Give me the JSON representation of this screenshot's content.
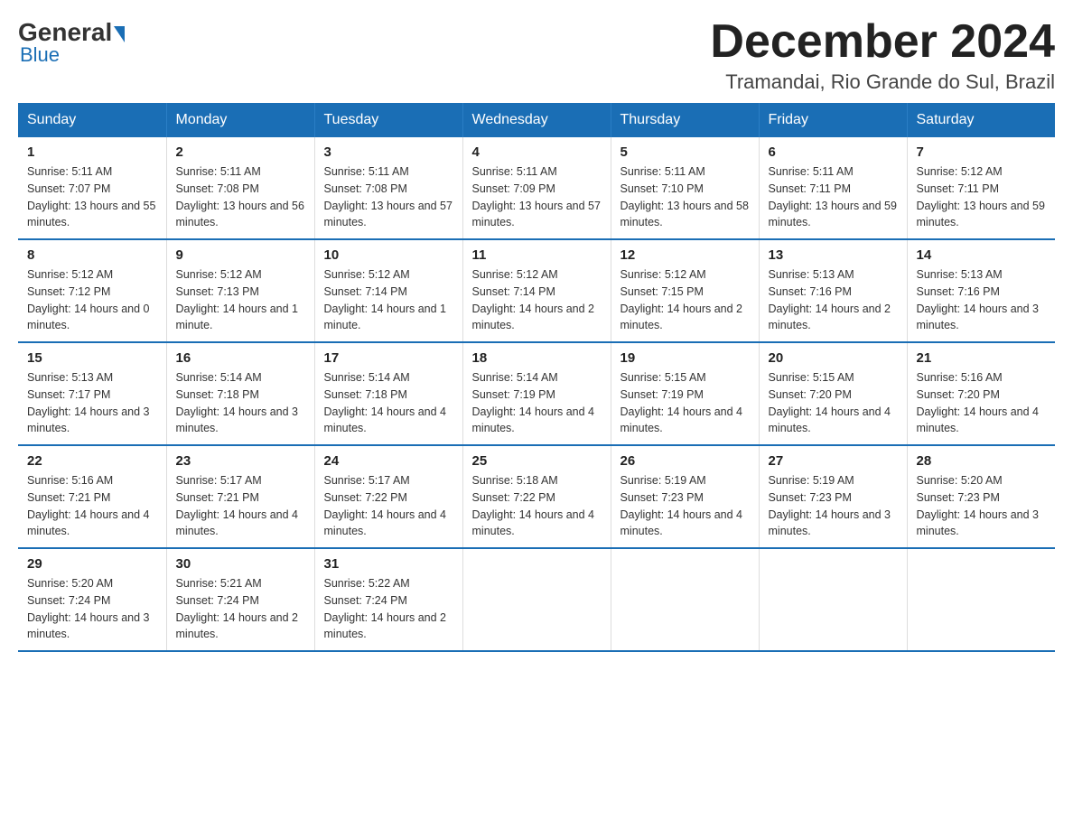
{
  "header": {
    "logo_general": "General",
    "logo_blue": "Blue",
    "month_title": "December 2024",
    "location": "Tramandai, Rio Grande do Sul, Brazil"
  },
  "weekdays": [
    "Sunday",
    "Monday",
    "Tuesday",
    "Wednesday",
    "Thursday",
    "Friday",
    "Saturday"
  ],
  "weeks": [
    [
      {
        "day": "1",
        "sunrise": "5:11 AM",
        "sunset": "7:07 PM",
        "daylight": "13 hours and 55 minutes."
      },
      {
        "day": "2",
        "sunrise": "5:11 AM",
        "sunset": "7:08 PM",
        "daylight": "13 hours and 56 minutes."
      },
      {
        "day": "3",
        "sunrise": "5:11 AM",
        "sunset": "7:08 PM",
        "daylight": "13 hours and 57 minutes."
      },
      {
        "day": "4",
        "sunrise": "5:11 AM",
        "sunset": "7:09 PM",
        "daylight": "13 hours and 57 minutes."
      },
      {
        "day": "5",
        "sunrise": "5:11 AM",
        "sunset": "7:10 PM",
        "daylight": "13 hours and 58 minutes."
      },
      {
        "day": "6",
        "sunrise": "5:11 AM",
        "sunset": "7:11 PM",
        "daylight": "13 hours and 59 minutes."
      },
      {
        "day": "7",
        "sunrise": "5:12 AM",
        "sunset": "7:11 PM",
        "daylight": "13 hours and 59 minutes."
      }
    ],
    [
      {
        "day": "8",
        "sunrise": "5:12 AM",
        "sunset": "7:12 PM",
        "daylight": "14 hours and 0 minutes."
      },
      {
        "day": "9",
        "sunrise": "5:12 AM",
        "sunset": "7:13 PM",
        "daylight": "14 hours and 1 minute."
      },
      {
        "day": "10",
        "sunrise": "5:12 AM",
        "sunset": "7:14 PM",
        "daylight": "14 hours and 1 minute."
      },
      {
        "day": "11",
        "sunrise": "5:12 AM",
        "sunset": "7:14 PM",
        "daylight": "14 hours and 2 minutes."
      },
      {
        "day": "12",
        "sunrise": "5:12 AM",
        "sunset": "7:15 PM",
        "daylight": "14 hours and 2 minutes."
      },
      {
        "day": "13",
        "sunrise": "5:13 AM",
        "sunset": "7:16 PM",
        "daylight": "14 hours and 2 minutes."
      },
      {
        "day": "14",
        "sunrise": "5:13 AM",
        "sunset": "7:16 PM",
        "daylight": "14 hours and 3 minutes."
      }
    ],
    [
      {
        "day": "15",
        "sunrise": "5:13 AM",
        "sunset": "7:17 PM",
        "daylight": "14 hours and 3 minutes."
      },
      {
        "day": "16",
        "sunrise": "5:14 AM",
        "sunset": "7:18 PM",
        "daylight": "14 hours and 3 minutes."
      },
      {
        "day": "17",
        "sunrise": "5:14 AM",
        "sunset": "7:18 PM",
        "daylight": "14 hours and 4 minutes."
      },
      {
        "day": "18",
        "sunrise": "5:14 AM",
        "sunset": "7:19 PM",
        "daylight": "14 hours and 4 minutes."
      },
      {
        "day": "19",
        "sunrise": "5:15 AM",
        "sunset": "7:19 PM",
        "daylight": "14 hours and 4 minutes."
      },
      {
        "day": "20",
        "sunrise": "5:15 AM",
        "sunset": "7:20 PM",
        "daylight": "14 hours and 4 minutes."
      },
      {
        "day": "21",
        "sunrise": "5:16 AM",
        "sunset": "7:20 PM",
        "daylight": "14 hours and 4 minutes."
      }
    ],
    [
      {
        "day": "22",
        "sunrise": "5:16 AM",
        "sunset": "7:21 PM",
        "daylight": "14 hours and 4 minutes."
      },
      {
        "day": "23",
        "sunrise": "5:17 AM",
        "sunset": "7:21 PM",
        "daylight": "14 hours and 4 minutes."
      },
      {
        "day": "24",
        "sunrise": "5:17 AM",
        "sunset": "7:22 PM",
        "daylight": "14 hours and 4 minutes."
      },
      {
        "day": "25",
        "sunrise": "5:18 AM",
        "sunset": "7:22 PM",
        "daylight": "14 hours and 4 minutes."
      },
      {
        "day": "26",
        "sunrise": "5:19 AM",
        "sunset": "7:23 PM",
        "daylight": "14 hours and 4 minutes."
      },
      {
        "day": "27",
        "sunrise": "5:19 AM",
        "sunset": "7:23 PM",
        "daylight": "14 hours and 3 minutes."
      },
      {
        "day": "28",
        "sunrise": "5:20 AM",
        "sunset": "7:23 PM",
        "daylight": "14 hours and 3 minutes."
      }
    ],
    [
      {
        "day": "29",
        "sunrise": "5:20 AM",
        "sunset": "7:24 PM",
        "daylight": "14 hours and 3 minutes."
      },
      {
        "day": "30",
        "sunrise": "5:21 AM",
        "sunset": "7:24 PM",
        "daylight": "14 hours and 2 minutes."
      },
      {
        "day": "31",
        "sunrise": "5:22 AM",
        "sunset": "7:24 PM",
        "daylight": "14 hours and 2 minutes."
      },
      null,
      null,
      null,
      null
    ]
  ]
}
